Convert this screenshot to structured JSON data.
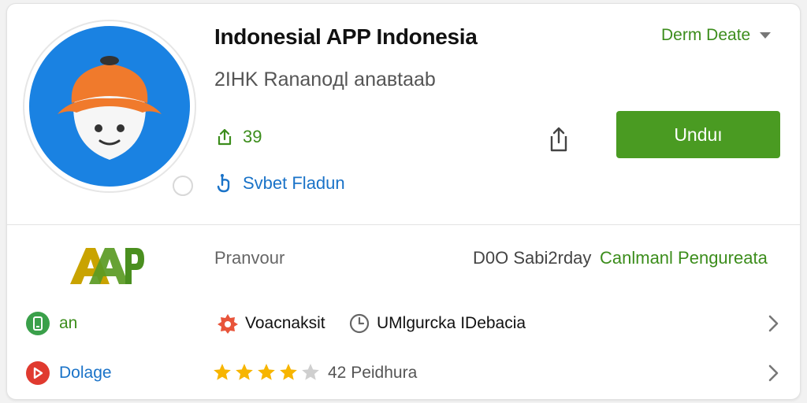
{
  "app": {
    "title": "Indonesial APP Indonesia",
    "subtitle": "2IHK Rananoдl anaвtaab",
    "dropdown_label": "Derm Deate",
    "share_count": "39",
    "link_text": "Svbet Fladun",
    "install_label": "Unduı",
    "logo_text": "AAP"
  },
  "info": {
    "publisher": "Pranvour",
    "size": "D0O Sabi2rday",
    "publisher_link": "Canlmanl Pengureata"
  },
  "rows": [
    {
      "label": "an",
      "features": [
        {
          "icon": "badge-icon",
          "text": "Voacnaksit"
        },
        {
          "icon": "clock-icon",
          "text": "UMlgurcka IDebacia"
        }
      ]
    },
    {
      "label": "Dolage",
      "rating": 4,
      "rating_max": 5,
      "rating_text": "42 Peidhura"
    }
  ],
  "colors": {
    "accent_green": "#4a9b22",
    "link_blue": "#1a73c8",
    "avatar_blue": "#1a82e2",
    "hat_orange": "#f07a2c",
    "star_yellow": "#f7b500"
  },
  "icons": {
    "share_stat": "share-icon",
    "link": "hand-icon",
    "share_button": "share-icon",
    "row1": "phone-icon",
    "row2": "location-icon",
    "chevron": "chevron-right-icon"
  }
}
